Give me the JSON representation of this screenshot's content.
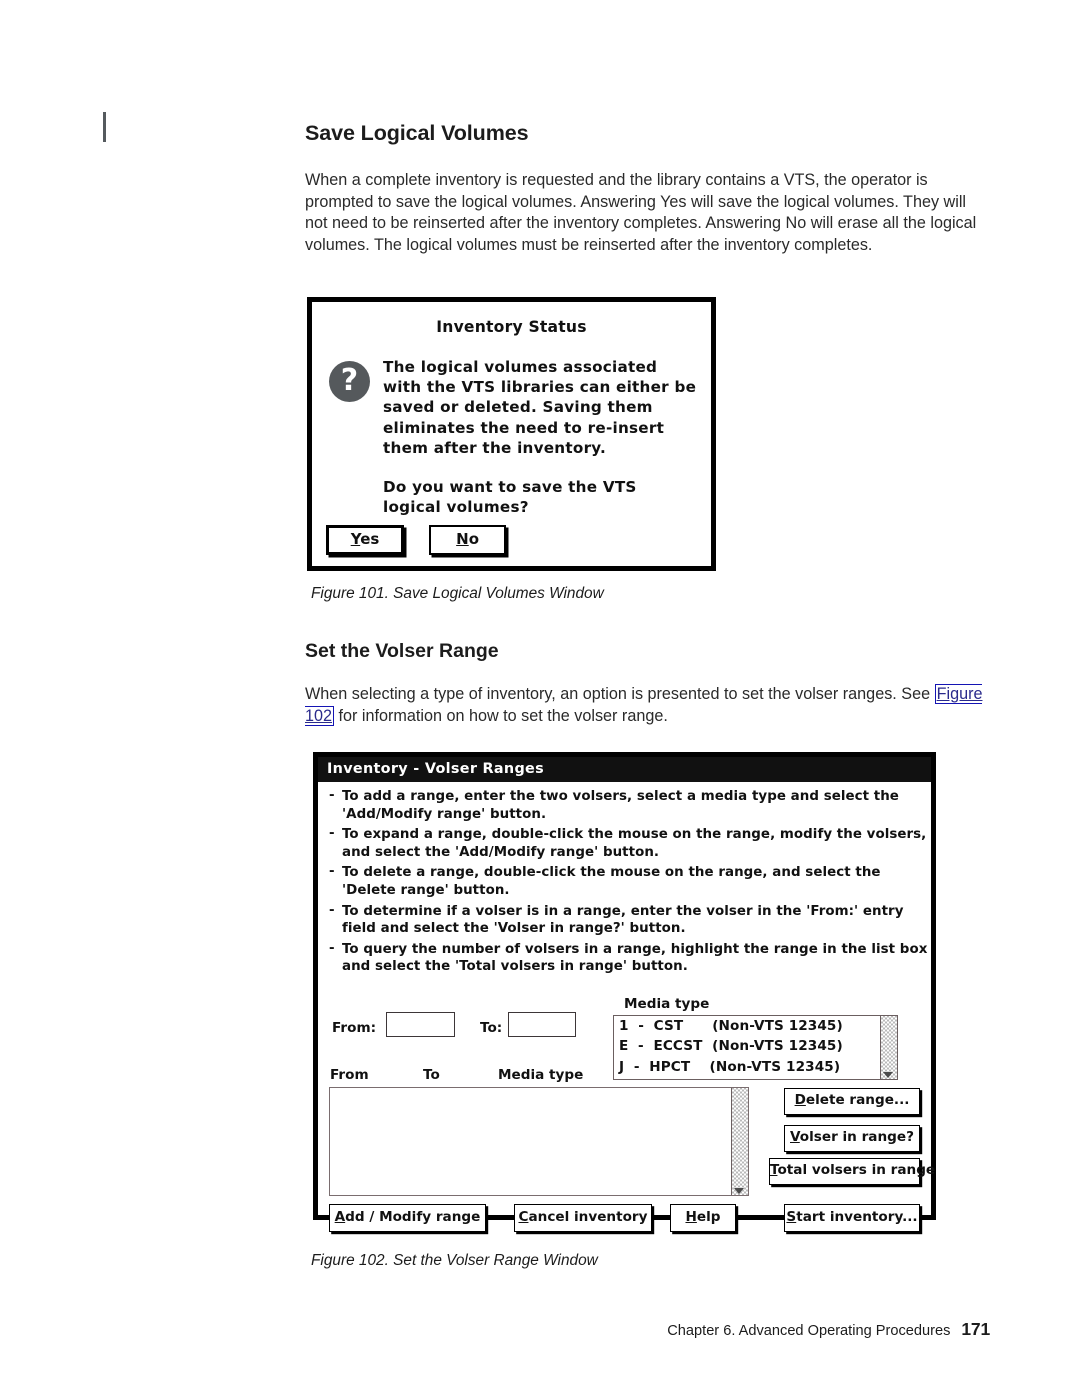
{
  "document": {
    "heading_1": "Save Logical Volumes",
    "paragraph_1": "When a complete inventory is requested and the library contains a VTS, the operator is prompted to save the logical volumes. Answering Yes will save the logical volumes. They will not need to be reinserted after the inventory completes. Answering No will erase all the logical volumes. The logical volumes must be reinserted after the inventory completes.",
    "figure_caption_101": "Figure 101. Save Logical Volumes Window",
    "heading_2": "Set the Volser Range",
    "paragraph_2_before_link": "When selecting a type of inventory, an option is presented to set the volser ranges. See ",
    "paragraph_2_link": "Figure 102",
    "paragraph_2_after_link": " for information on how to set the volser range.",
    "figure_caption_102": "Figure 102. Set the Volser Range Window",
    "footer_chapter": "Chapter 6. Advanced Operating Procedures",
    "footer_page_number": "171",
    "link_color": "#2a2a8c"
  },
  "dialog": {
    "title": "Inventory Status",
    "icon": "question-mark-icon",
    "icon_glyph": "?",
    "message_paragraph_1": "The logical volumes associated with the VTS libraries can either be saved or deleted. Saving them eliminates the need to re-insert them after the inventory.",
    "message_paragraph_2": "Do you want to save the VTS logical volumes?",
    "buttons": [
      {
        "label": "Yes",
        "mnemonic": "Y",
        "rest": "es",
        "default": true
      },
      {
        "label": "No",
        "mnemonic": "N",
        "rest": "o",
        "default": false
      }
    ]
  },
  "window": {
    "title": "Inventory - Volser Ranges",
    "hints": [
      "To add a range, enter the two volsers, select a media type and select the 'Add/Modify range' button.",
      "To expand a range, double-click the mouse on the range, modify the volsers, and select the 'Add/Modify range' button.",
      "To delete a range, double-click the mouse on the range, and select the 'Delete range' button.",
      "To determine if a volser is in a range, enter the volser in the 'From:' entry field and select the 'Volser in range?' button.",
      "To query the number of volsers in a range, highlight the range in the list box and select the 'Total volsers in range' button."
    ],
    "form": {
      "from_label": "From:",
      "from_value": "",
      "to_label": "To:",
      "to_value": "",
      "media_type_label": "Media type"
    },
    "column_headers": {
      "from": "From",
      "to": "To",
      "media_type": "Media type"
    },
    "media_type_options": [
      "1  -  CST      (Non-VTS 12345)",
      "E  -  ECCST  (Non-VTS 12345)",
      "J  -  HPCT    (Non-VTS 12345)"
    ],
    "ranges_list_items": [],
    "buttons": {
      "delete_range": {
        "mnemonic": "D",
        "rest": "elete range..."
      },
      "volser_in_range": {
        "mnemonic": "V",
        "rest": "olser in range?"
      },
      "total_volsers": {
        "mnemonic": "T",
        "rest": "otal volsers in range"
      },
      "add_modify": {
        "mnemonic": "A",
        "rest": "dd / Modify range"
      },
      "cancel_inventory": {
        "mnemonic": "C",
        "rest": "ancel inventory"
      },
      "help": {
        "mnemonic": "H",
        "rest": "elp"
      },
      "start_inventory": {
        "mnemonic": "S",
        "rest": "tart inventory..."
      }
    }
  }
}
